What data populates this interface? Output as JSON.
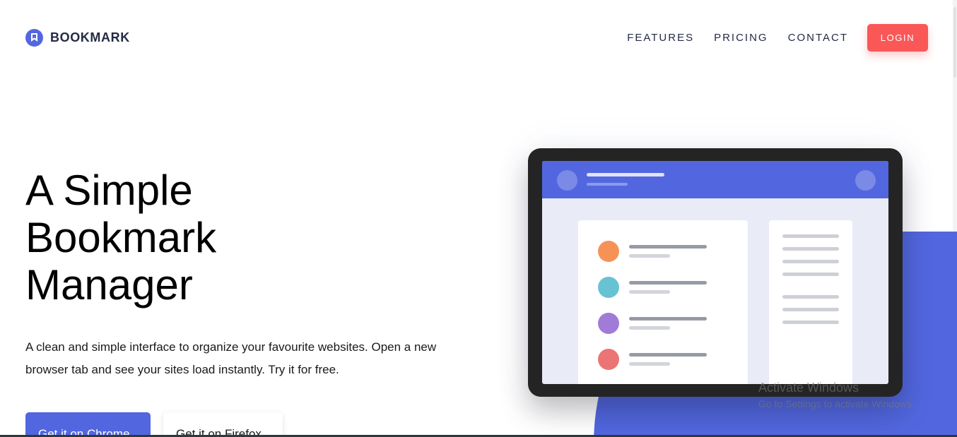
{
  "header": {
    "logo_text": "BOOKMARK",
    "nav": [
      "FEATURES",
      "PRICING",
      "CONTACT"
    ],
    "login_label": "LOGIN"
  },
  "hero": {
    "title": "A Simple Bookmark Manager",
    "description": "A clean and simple interface to organize your favourite websites. Open a new browser tab and see your sites load instantly. Try it for free.",
    "chrome_label": "Get it on Chrome",
    "firefox_label": "Get it on Firefox"
  },
  "illustration": {
    "dot_colors": [
      "#f79256",
      "#67c2d4",
      "#a07bd8",
      "#ec7474"
    ]
  },
  "watermark": {
    "title": "Activate Windows",
    "subtitle": "Go to Settings to activate Windows."
  },
  "colors": {
    "primary": "#5267df",
    "accent": "#fa5757"
  }
}
